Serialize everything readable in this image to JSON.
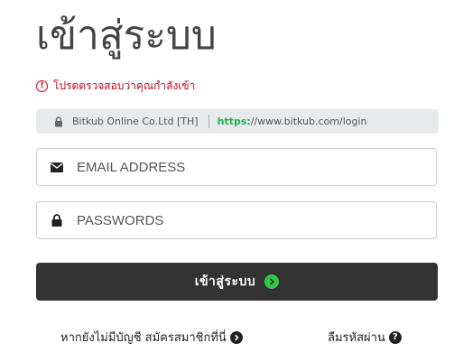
{
  "page": {
    "title": "เข้าสู่ระบบ"
  },
  "warning": {
    "text": "โปรดตรวจสอบว่าคุณกำลังเข้า",
    "icon": "exclamation-circle-icon",
    "color": "#d0021b"
  },
  "urlbar": {
    "company": "Bitkub Online Co.Ltd [TH]",
    "scheme": "https:",
    "rest": "//www.bitkub.com/login",
    "scheme_color": "#22b14c"
  },
  "form": {
    "email_placeholder": "EMAIL ADDRESS",
    "email_value": "",
    "email_icon": "envelope-icon",
    "password_placeholder": "PASSWORDS",
    "password_value": "",
    "password_icon": "lock-icon",
    "submit_label": "เข้าสู่ระบบ",
    "submit_icon": "arrow-circle-right-icon",
    "submit_bg": "#333333",
    "submit_icon_color": "#2ecc40"
  },
  "links": {
    "register": "หากยังไม่มีบัญชี สมัครสมาชิกที่นี่",
    "register_icon": "chevron-circle-right-icon",
    "forgot": "ลืมรหัสผ่าน",
    "forgot_icon": "question-circle-icon"
  }
}
